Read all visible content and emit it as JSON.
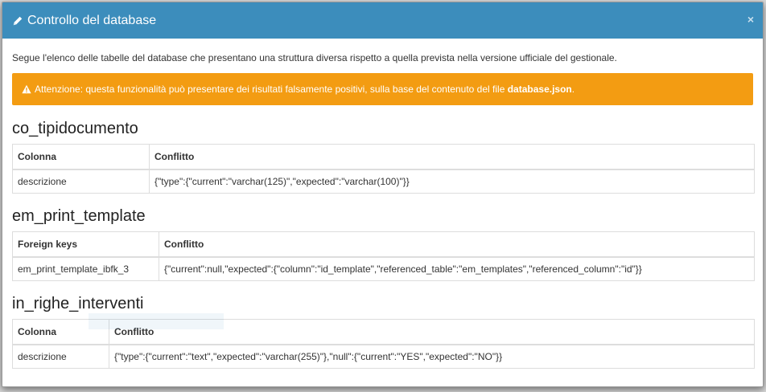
{
  "modal": {
    "title": "Controllo del database",
    "close_label": "×",
    "intro": "Segue l'elenco delle tabelle del database che presentano una struttura diversa rispetto a quella prevista nella versione ufficiale del gestionale.",
    "warning": {
      "prefix": "Attenzione: questa funzionalità può presentare dei risultati falsamente positivi, sulla base del contenuto del file ",
      "file": "database.json",
      "suffix": "."
    },
    "colors": {
      "header": "#3c8dbc",
      "warning": "#f39c12"
    }
  },
  "sections": [
    {
      "title": "co_tipidocumento",
      "col1": "Colonna",
      "col2": "Conflitto",
      "rows": [
        {
          "name": "descrizione",
          "conflict": "{\"type\":{\"current\":\"varchar(125)\",\"expected\":\"varchar(100)\"}}"
        }
      ]
    },
    {
      "title": "em_print_template",
      "col1": "Foreign keys",
      "col2": "Conflitto",
      "rows": [
        {
          "name": "em_print_template_ibfk_3",
          "conflict": "{\"current\":null,\"expected\":{\"column\":\"id_template\",\"referenced_table\":\"em_templates\",\"referenced_column\":\"id\"}}"
        }
      ]
    },
    {
      "title": "in_righe_interventi",
      "col1": "Colonna",
      "col2": "Conflitto",
      "rows": [
        {
          "name": "descrizione",
          "conflict": "{\"type\":{\"current\":\"text\",\"expected\":\"varchar(255)\"},\"null\":{\"current\":\"YES\",\"expected\":\"NO\"}}"
        }
      ]
    }
  ]
}
